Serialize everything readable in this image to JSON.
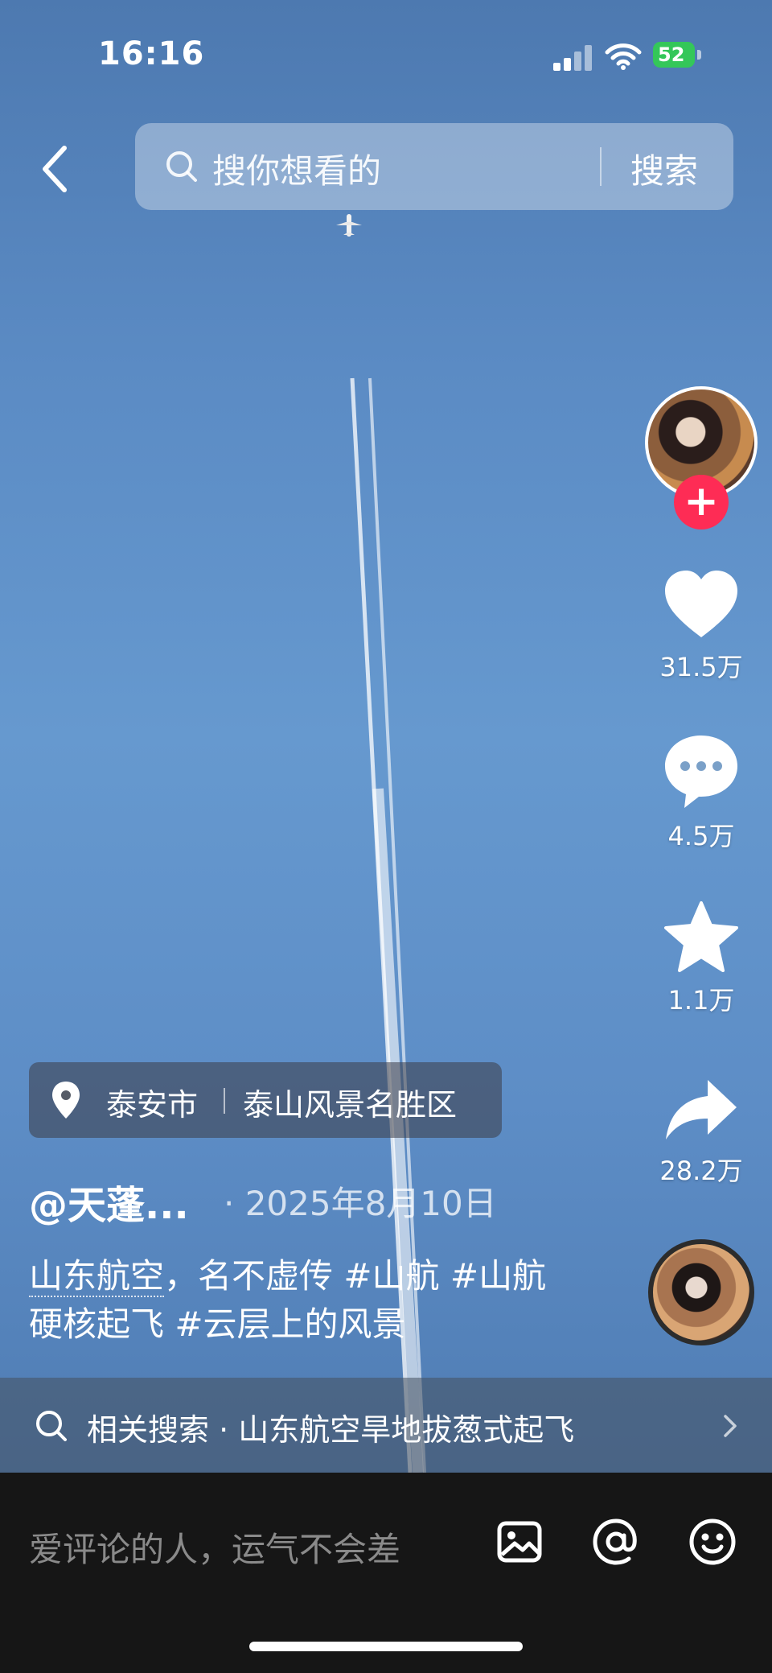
{
  "status_bar": {
    "time": "16:16",
    "battery_level": "52"
  },
  "search": {
    "placeholder": "搜你想看的",
    "button_label": "搜索"
  },
  "creator": {
    "follow_label": "+"
  },
  "actions": {
    "likes": "31.5万",
    "comments": "4.5万",
    "favorites": "1.1万",
    "shares": "28.2万"
  },
  "location": {
    "city": "泰安市",
    "area": "泰山风景名胜区"
  },
  "post": {
    "username": "@天蓬...",
    "date": "· 2025年8月10日",
    "caption_link": "山东航空",
    "caption_rest": "，名不虚传 #山航 #山航硬核起飞 #云层上的风景"
  },
  "related": {
    "text": "相关搜索 · 山东航空旱地拔葱式起飞"
  },
  "comment_bar": {
    "placeholder": "爱评论的人，运气不会差"
  },
  "icons": {
    "back": "chevron-left-icon",
    "search": "search-icon",
    "like": "heart-icon",
    "comment": "comment-bubble-icon",
    "favorite": "star-icon",
    "share": "share-arrow-icon",
    "location": "location-pin-icon",
    "image": "image-icon",
    "mention": "at-icon",
    "emoji": "emoji-icon"
  },
  "colors": {
    "follow_badge": "#fe2c55",
    "battery": "#34c759",
    "comment_bar_bg": "#161616"
  }
}
